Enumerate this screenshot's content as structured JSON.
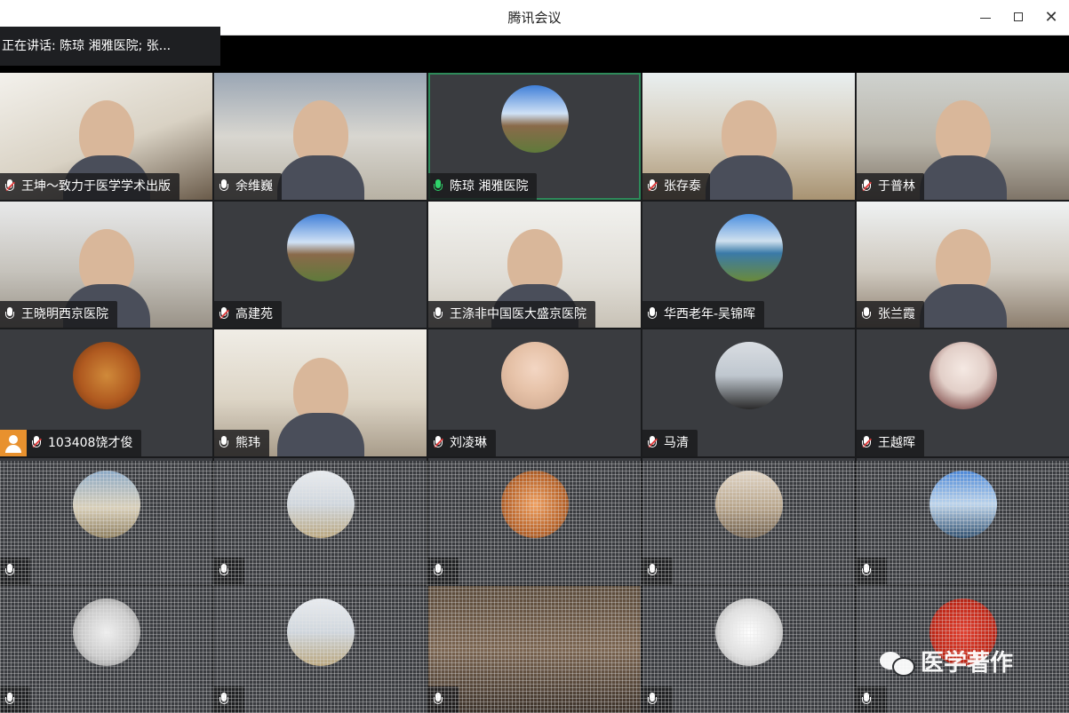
{
  "window": {
    "title": "腾讯会议"
  },
  "speaking_bar": {
    "text": "正在讲话:  陈琼  湘雅医院; 张..."
  },
  "tiles": [
    {
      "name": "王坤～致力于医学学术出版",
      "type": "video"
    },
    {
      "name": "余维巍",
      "type": "video"
    },
    {
      "name": "陈琼  湘雅医院",
      "type": "avatar",
      "avatar": "mountain",
      "speaking": true
    },
    {
      "name": "张存泰",
      "type": "video"
    },
    {
      "name": "于普林",
      "type": "video"
    },
    {
      "name": "王晓明西京医院",
      "type": "video"
    },
    {
      "name": "高建苑",
      "type": "avatar",
      "avatar": "mountain",
      "muted": true
    },
    {
      "name": "王涤非中国医大盛京医院",
      "type": "video"
    },
    {
      "name": "华西老年-吴锦晖",
      "type": "avatar",
      "avatar": "lake"
    },
    {
      "name": "张兰霞",
      "type": "video"
    },
    {
      "name": "103408饶才俊",
      "type": "avatar",
      "avatar": "badge",
      "muted": true,
      "user_icon": true
    },
    {
      "name": "熊玮",
      "type": "video"
    },
    {
      "name": "刘凌琳",
      "type": "avatar",
      "avatar": "child",
      "muted": true
    },
    {
      "name": "马清",
      "type": "avatar",
      "avatar": "woman",
      "muted": true
    },
    {
      "name": "王越晖",
      "type": "avatar",
      "avatar": "doctor",
      "muted": true
    }
  ],
  "watermark": {
    "text": "医学著作"
  }
}
